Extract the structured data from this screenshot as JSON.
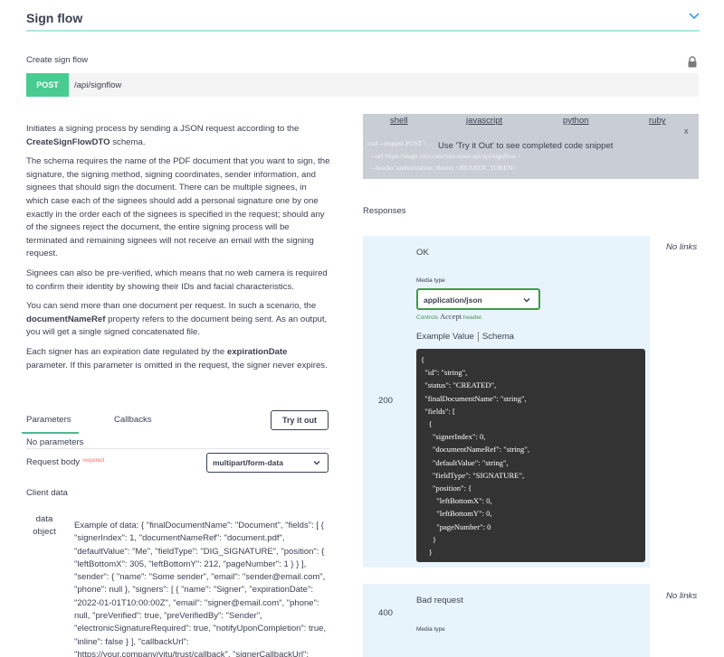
{
  "header": {
    "title": "Sign flow"
  },
  "operation": {
    "summary": "Create sign flow",
    "method": "POST",
    "path": "/api/signflow"
  },
  "description": {
    "p1_a": "Initiates a signing process by sending a JSON request according to the",
    "p1_b": "CreateSignFlowDTO",
    "p1_c": " schema.",
    "p2": "The schema requires the name of the PDF document that you want to sign, the signature, the signing method, signing coordinates, sender information, and signees that should sign the document. There can be multiple signees, in which case each of the signees should add a personal signature one by one exactly in the order each of the signees is specified in the request; should any of the signees reject the document, the entire signing process will be terminated and remaining signees will not receive an email with the signing request.",
    "p3": "Signees can also be pre-verified, which means that no web camera is required to confirm their identity by showing their IDs and facial characteristics.",
    "p4_a": "You can send more than one document per request. In such a scenario, the ",
    "p4_b": "documentNameRef",
    "p4_c": " property refers to the document being sent. As an output, you will get a single signed concatenated file.",
    "p5_a": "Each signer has an expiration date regulated by the ",
    "p5_b": "expirationDate",
    "p5_c": " parameter. If this parameter is omitted in the request, the signer never expires."
  },
  "tabs": {
    "parameters": "Parameters",
    "callbacks": "Callbacks",
    "try_button": "Try it out"
  },
  "parameters": {
    "none": "No parameters"
  },
  "request_body": {
    "label": "Request body",
    "required": "required",
    "content_type": "multipart/form-data"
  },
  "client_data": {
    "title": "Client data",
    "field_name_1": "data",
    "field_name_2": "object",
    "example": "Example of data: { \"finalDocumentName\": \"Document\", \"fields\": [ { \"signerIndex\": 1, \"documentNameRef\": \"document.pdf\", \"defaultValue\": \"Me\", \"fieldType\": \"DIG_SIGNATURE\", \"position\": { \"leftBottomX\": 305, \"leftBottomY\": 212, \"pageNumber\": 1 } } ], \"sender\": { \"name\": \"Some sender\", \"email\": \"sender@email.com\", \"phone\": null }, \"signers\": [ { \"name\": \"Signer\", \"expirationDate\": \"2022-01-01T10:00:00Z\", \"email\": \"signer@email.com\", \"phone\": null, \"preVerified\": true, \"preVerifiedBy\": \"Sender\", \"electronicSignatureRequired\": true, \"notifyUponCompletion\": true, \"inline\": false } ], \"callbackUrl\": \"https://your.company/vitu/trust/callback\", \"signerCallbackUrl\":"
  },
  "code_samples": {
    "tabs": [
      "shell",
      "javascript",
      "python",
      "ruby"
    ],
    "close": "x",
    "line1": "curl --request POST \\",
    "line2": "--url https://stage.vitu.com/vitu-trust-api/api/signflow \\",
    "line3": "--header 'authorization: Bearer <BEARER_TOKEN>'",
    "message": "Use 'Try it Out' to see completed code snippet"
  },
  "responses": {
    "title": "Responses",
    "no_links": "No links",
    "r200": {
      "code": "200",
      "description": "OK",
      "media_type_label": "Media type",
      "media_type": "application/json",
      "controls_prefix": "Controls ",
      "controls_accept": "Accept",
      "controls_suffix": " header.",
      "example_value": "Example Value",
      "schema": "Schema",
      "example_json": "{\n  \"id\": \"string\",\n  \"status\": \"CREATED\",\n  \"finalDocumentName\": \"string\",\n  \"fields\": [\n    {\n      \"signerIndex\": 0,\n      \"documentNameRef\": \"string\",\n      \"defaultValue\": \"string\",\n      \"fieldType\": \"SIGNATURE\",\n      \"position\": {\n        \"leftBottomX\": 0,\n        \"leftBottomY\": 0,\n        \"pageNumber\": 0\n      }\n    }\n  ],"
    },
    "r400": {
      "code": "400",
      "description": "Bad request",
      "media_type_label": "Media type"
    }
  },
  "colors": {
    "post_method": "#49cc90",
    "response_bg": "#e8f4fb",
    "media_select_border": "#3e9b46",
    "required": "#ff6f6f",
    "code_panel": "#c9cdd4",
    "json_bg": "#333333"
  },
  "icons": [
    "chevron-down-icon",
    "lock-icon",
    "caret-down-icon"
  ]
}
